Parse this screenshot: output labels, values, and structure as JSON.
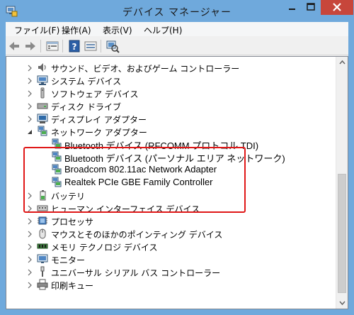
{
  "window": {
    "title": "デバイス マネージャー",
    "accent_color": "#6fa9dc",
    "close_color": "#c7463b"
  },
  "menu": {
    "items": [
      {
        "label": "ファイル(F)"
      },
      {
        "label": "操作(A)"
      },
      {
        "label": "表示(V)"
      },
      {
        "label": "ヘルプ(H)"
      }
    ]
  },
  "toolbar": {
    "icons": [
      "back-arrow-icon",
      "forward-arrow-icon",
      "properties-icon",
      "help-icon",
      "view-icon",
      "scan-hardware-icon"
    ]
  },
  "tree": {
    "categories": [
      {
        "label": "サウンド、ビデオ、およびゲーム コントローラー",
        "icon": "speaker-icon",
        "expanded": false
      },
      {
        "label": "システム デバイス",
        "icon": "system-device-icon",
        "expanded": false
      },
      {
        "label": "ソフトウェア デバイス",
        "icon": "software-device-icon",
        "expanded": false
      },
      {
        "label": "ディスク ドライブ",
        "icon": "disk-drive-icon",
        "expanded": false
      },
      {
        "label": "ディスプレイ アダプター",
        "icon": "display-adapter-icon",
        "expanded": false
      },
      {
        "label": "ネットワーク アダプター",
        "icon": "network-adapter-icon",
        "expanded": true
      },
      {
        "label": "バッテリ",
        "icon": "battery-icon",
        "expanded": false
      },
      {
        "label": "ヒューマン インターフェイス デバイス",
        "icon": "hid-icon",
        "expanded": false
      },
      {
        "label": "プロセッサ",
        "icon": "processor-icon",
        "expanded": false
      },
      {
        "label": "マウスとそのほかのポインティング デバイス",
        "icon": "mouse-icon",
        "expanded": false
      },
      {
        "label": "メモリ テクノロジ デバイス",
        "icon": "memory-icon",
        "expanded": false
      },
      {
        "label": "モニター",
        "icon": "monitor-icon",
        "expanded": false
      },
      {
        "label": "ユニバーサル シリアル バス コントローラー",
        "icon": "usb-icon",
        "expanded": false
      },
      {
        "label": "印刷キュー",
        "icon": "printer-icon",
        "expanded": false
      }
    ],
    "network_children": [
      {
        "label": "Bluetooth デバイス (RFCOMM プロトコル TDI)"
      },
      {
        "label": "Bluetooth デバイス (パーソナル エリア ネットワーク)"
      },
      {
        "label": "Broadcom 802.11ac Network Adapter"
      },
      {
        "label": "Realtek PCIe GBE Family Controller"
      }
    ],
    "highlight_color": "#e01818"
  }
}
